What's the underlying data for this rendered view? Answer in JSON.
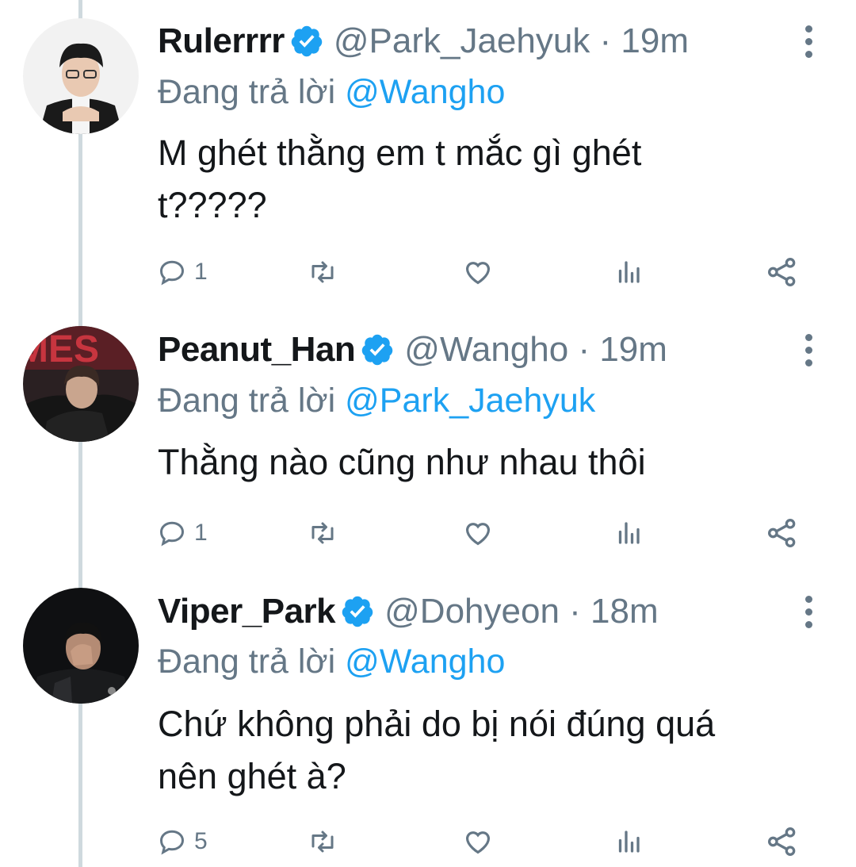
{
  "icons": {
    "verified": "verified-badge-icon",
    "more": "more-options-icon",
    "reply": "reply-icon",
    "retweet": "retweet-icon",
    "like": "like-icon",
    "analytics": "analytics-icon",
    "share": "share-icon"
  },
  "colors": {
    "accent": "#1da1f2",
    "secondary_text": "#657786",
    "thread_line": "#cfd9de"
  },
  "tweets": [
    {
      "name": "Rulerrrr",
      "handle": "@Park_Jaehyuk",
      "time": "19m",
      "handle_time": "@Park_Jaehyuk · 19m",
      "reply_prefix": "Đang trả lời",
      "reply_mention": "@Wangho",
      "text_lines": [
        "M ghét thằng em t mắc gì ghét",
        "t?????"
      ],
      "reply_count": "1"
    },
    {
      "name": "Peanut_Han",
      "handle": "@Wangho",
      "time": "19m",
      "handle_time": "@Wangho · 19m",
      "reply_prefix": "Đang trả lời",
      "reply_mention": "@Park_Jaehyuk",
      "text_lines": [
        "Thằng nào cũng như nhau thôi"
      ],
      "reply_count": "1"
    },
    {
      "name": "Viper_Park",
      "handle": "@Dohyeon",
      "time": "18m",
      "handle_time": "@Dohyeon · 18m",
      "reply_prefix": "Đang trả lời",
      "reply_mention": "@Wangho",
      "text_lines": [
        "Chứ không phải do bị nói đúng quá",
        "nên ghét à?"
      ],
      "reply_count": "5"
    }
  ]
}
